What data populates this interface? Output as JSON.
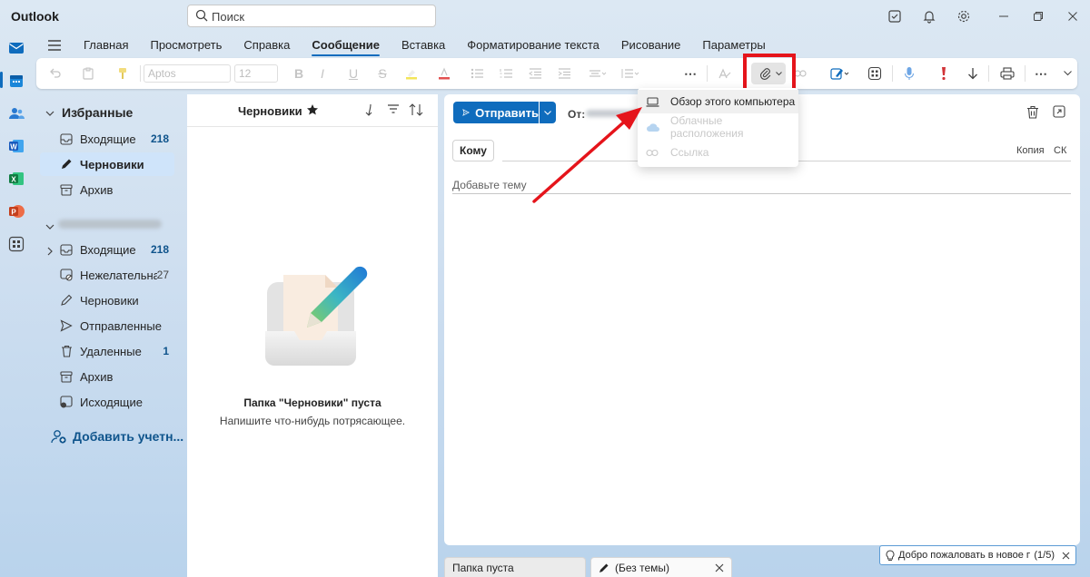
{
  "app": {
    "title": "Outlook"
  },
  "search": {
    "placeholder": "Поиск"
  },
  "tabs": [
    "Главная",
    "Просмотреть",
    "Справка",
    "Сообщение",
    "Вставка",
    "Форматирование текста",
    "Рисование",
    "Параметры"
  ],
  "toolbar": {
    "font_name": "Aptos",
    "font_size": "12"
  },
  "folders": {
    "favorites_label": "Избранные",
    "favorites": [
      {
        "label": "Входящие",
        "count": "218"
      },
      {
        "label": "Черновики",
        "count": ""
      },
      {
        "label": "Архив",
        "count": ""
      }
    ],
    "account_items": [
      {
        "label": "Входящие",
        "count": "218"
      },
      {
        "label": "Нежелательна...",
        "count": "27"
      },
      {
        "label": "Черновики",
        "count": ""
      },
      {
        "label": "Отправленные",
        "count": ""
      },
      {
        "label": "Удаленные",
        "count": "1"
      },
      {
        "label": "Архив",
        "count": ""
      },
      {
        "label": "Исходящие",
        "count": ""
      }
    ],
    "add_account": "Добавить учетн..."
  },
  "message_list": {
    "title": "Черновики",
    "empty_title": "Папка \"Черновики\" пуста",
    "empty_subtitle": "Напишите что-нибудь потрясающее."
  },
  "compose": {
    "send_label": "Отправить",
    "from_label": "От:",
    "to_label": "Кому",
    "cc_label": "Копия",
    "bcc_label": "СК",
    "subject_placeholder": "Добавьте тему"
  },
  "attach_menu": [
    {
      "label": "Обзор этого компьютера",
      "icon": "laptop-icon",
      "enabled": true
    },
    {
      "label": "Облачные расположения",
      "icon": "cloud-icon",
      "enabled": false
    },
    {
      "label": "Ссылка",
      "icon": "link-icon",
      "enabled": false
    }
  ],
  "bottom_tabs": {
    "tab1": "Папка пуста",
    "tab2": "(Без темы)"
  },
  "welcome": {
    "text": "Добро пожаловать в новое при...",
    "counter": "(1/5)"
  },
  "colors": {
    "accent": "#0f6cbd",
    "highlight": "#e5141b"
  }
}
